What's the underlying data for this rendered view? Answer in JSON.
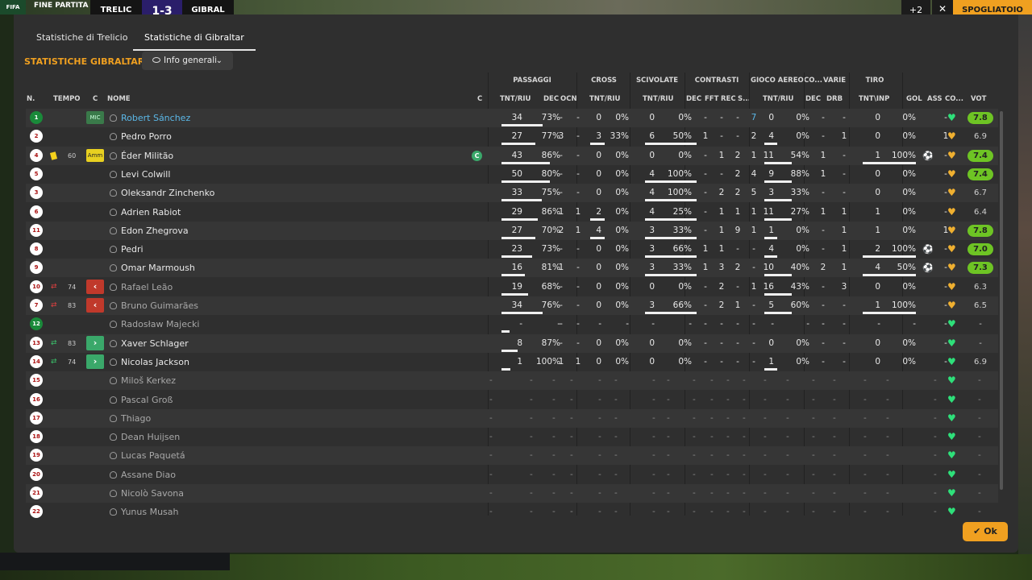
{
  "topbar": {
    "logo": "FIFA",
    "status": "FINE PARTITA",
    "home_team": "TRELIC",
    "score": "1-3",
    "away_team": "GIBRAL",
    "btn1": "+2",
    "close": "✕",
    "dressing_room": "SPOGLIATOIO"
  },
  "tabs": [
    "Statistiche di Trelicio",
    "Statistiche di Gibraltar"
  ],
  "section_title": "STATISTICHE GIBRALTAR",
  "filter": {
    "label": "Info generali"
  },
  "groups": {
    "passaggi": "PASSAGGI",
    "cross": "CROSS",
    "scivolate": "SCIVOLATE",
    "contrasti": "CONTRASTI",
    "gioco_aereo": "GIOCO AEREO",
    "co": "CO...",
    "varie": "VARIE",
    "tiro": "TIRO"
  },
  "columns": {
    "n": "N.",
    "tempo": "TEMPO",
    "c": "C",
    "nome": "NOME",
    "c2": "C",
    "pas_tnt": "TNT/RIU",
    "pas_dec": "DEC",
    "pas_ocn": "OCN",
    "cross_tnt": "TNT/RIU",
    "sci_tnt": "TNT/RIU",
    "con_dec": "DEC",
    "con_fft": "FFT",
    "con_rec": "REC",
    "con_s": "S...",
    "aer_tnt": "TNT/RIU",
    "co_dec": "DEC",
    "var_drb": "DRB",
    "tiro_tnt": "TNT\\INP",
    "gol": "GOL",
    "ass": "ASS",
    "co2": "CO...",
    "vot": "VOT"
  },
  "players": [
    {
      "num": "1",
      "gk": true,
      "pos": "MIC",
      "name": "Robert Sánchez",
      "sel": true,
      "pas": [
        "34",
        "73%"
      ],
      "pdec": "-",
      "pocn": "-",
      "cross": [
        "0",
        "0%"
      ],
      "sci": [
        "0",
        "0%"
      ],
      "cdec": "-",
      "cfft": "-",
      "crec": "-",
      "cs": "7",
      "aer": [
        "0",
        "0%"
      ],
      "codec": "-",
      "drb": "-",
      "tiro": [
        "0",
        "0%"
      ],
      "gol": "",
      "ass": "-",
      "heart": "green",
      "vot": "7.8",
      "vgreen": true
    },
    {
      "num": "2",
      "name": "Pedro Porro",
      "pas": [
        "27",
        "77%"
      ],
      "pdec": "3",
      "pocn": "-",
      "cross": [
        "3",
        "33%"
      ],
      "sci": [
        "6",
        "50%"
      ],
      "cdec": "1",
      "cfft": "-",
      "crec": "-",
      "cs": "2",
      "aer": [
        "4",
        "0%"
      ],
      "codec": "-",
      "drb": "1",
      "tiro": [
        "0",
        "0%"
      ],
      "gol": "",
      "ass": "1",
      "heart": "gold",
      "vot": "6.9"
    },
    {
      "num": "4",
      "card": true,
      "tmin": "60",
      "pos": "Amm",
      "name": "Éder Militão",
      "cap": "C",
      "pas": [
        "43",
        "86%"
      ],
      "pdec": "-",
      "pocn": "-",
      "cross": [
        "0",
        "0%"
      ],
      "sci": [
        "0",
        "0%"
      ],
      "cdec": "-",
      "cfft": "1",
      "crec": "2",
      "cs": "1",
      "aer": [
        "11",
        "54%"
      ],
      "codec": "1",
      "drb": "-",
      "tiro": [
        "1",
        "100%"
      ],
      "gol": "⚽",
      "ass": "-",
      "heart": "gold",
      "vot": "7.4",
      "vgreen": true
    },
    {
      "num": "5",
      "name": "Levi Colwill",
      "pas": [
        "50",
        "80%"
      ],
      "pdec": "-",
      "pocn": "-",
      "cross": [
        "0",
        "0%"
      ],
      "sci": [
        "4",
        "100%"
      ],
      "cdec": "-",
      "cfft": "-",
      "crec": "2",
      "cs": "4",
      "aer": [
        "9",
        "88%"
      ],
      "codec": "1",
      "drb": "-",
      "tiro": [
        "0",
        "0%"
      ],
      "gol": "",
      "ass": "-",
      "heart": "gold",
      "vot": "7.4",
      "vgreen": true
    },
    {
      "num": "3",
      "name": "Oleksandr Zinchenko",
      "pas": [
        "33",
        "75%"
      ],
      "pdec": "-",
      "pocn": "-",
      "cross": [
        "0",
        "0%"
      ],
      "sci": [
        "4",
        "100%"
      ],
      "cdec": "-",
      "cfft": "2",
      "crec": "2",
      "cs": "5",
      "aer": [
        "3",
        "33%"
      ],
      "codec": "-",
      "drb": "-",
      "tiro": [
        "0",
        "0%"
      ],
      "gol": "",
      "ass": "-",
      "heart": "gold",
      "vot": "6.7"
    },
    {
      "num": "6",
      "name": "Adrien Rabiot",
      "pas": [
        "29",
        "86%"
      ],
      "pdec": "1",
      "pocn": "1",
      "cross": [
        "2",
        "0%"
      ],
      "sci": [
        "4",
        "25%"
      ],
      "cdec": "-",
      "cfft": "1",
      "crec": "1",
      "cs": "1",
      "aer": [
        "11",
        "27%"
      ],
      "codec": "1",
      "drb": "1",
      "tiro": [
        "1",
        "0%"
      ],
      "gol": "",
      "ass": "-",
      "heart": "gold",
      "vot": "6.4"
    },
    {
      "num": "11",
      "name": "Edon Zhegrova",
      "pas": [
        "27",
        "70%"
      ],
      "pdec": "2",
      "pocn": "1",
      "cross": [
        "4",
        "0%"
      ],
      "sci": [
        "3",
        "33%"
      ],
      "cdec": "-",
      "cfft": "1",
      "crec": "9",
      "cs": "1",
      "aer": [
        "1",
        "0%"
      ],
      "codec": "-",
      "drb": "1",
      "tiro": [
        "1",
        "0%"
      ],
      "gol": "",
      "ass": "1",
      "heart": "gold",
      "vot": "7.8",
      "vgreen": true
    },
    {
      "num": "8",
      "name": "Pedri",
      "pas": [
        "23",
        "73%"
      ],
      "pdec": "-",
      "pocn": "-",
      "cross": [
        "0",
        "0%"
      ],
      "sci": [
        "3",
        "66%"
      ],
      "cdec": "1",
      "cfft": "1",
      "crec": "-",
      "cs": "-",
      "aer": [
        "4",
        "0%"
      ],
      "codec": "-",
      "drb": "1",
      "tiro": [
        "2",
        "100%"
      ],
      "gol": "⚽",
      "ass": "-",
      "heart": "gold",
      "vot": "7.0",
      "vgreen": true
    },
    {
      "num": "9",
      "name": "Omar Marmoush",
      "pas": [
        "16",
        "81%"
      ],
      "pdec": "1",
      "pocn": "-",
      "cross": [
        "0",
        "0%"
      ],
      "sci": [
        "3",
        "33%"
      ],
      "cdec": "1",
      "cfft": "3",
      "crec": "2",
      "cs": "-",
      "aer": [
        "10",
        "40%"
      ],
      "codec": "2",
      "drb": "1",
      "tiro": [
        "4",
        "50%"
      ],
      "gol": "⚽",
      "ass": "-",
      "heart": "gold",
      "vot": "7.3",
      "vgreen": true
    },
    {
      "num": "10",
      "swap": "out",
      "tmin": "74",
      "sub": "out",
      "name": "Rafael Leão",
      "dim": true,
      "pas": [
        "19",
        "68%"
      ],
      "pdec": "-",
      "pocn": "-",
      "cross": [
        "0",
        "0%"
      ],
      "sci": [
        "0",
        "0%"
      ],
      "cdec": "-",
      "cfft": "2",
      "crec": "-",
      "cs": "1",
      "aer": [
        "16",
        "43%"
      ],
      "codec": "-",
      "drb": "3",
      "tiro": [
        "0",
        "0%"
      ],
      "gol": "",
      "ass": "-",
      "heart": "gold",
      "vot": "6.3"
    },
    {
      "num": "7",
      "swap": "out",
      "tmin": "83",
      "sub": "out",
      "name": "Bruno Guimarães",
      "dim": true,
      "pas": [
        "34",
        "76%"
      ],
      "pdec": "-",
      "pocn": "-",
      "cross": [
        "0",
        "0%"
      ],
      "sci": [
        "3",
        "66%"
      ],
      "cdec": "-",
      "cfft": "2",
      "crec": "1",
      "cs": "-",
      "aer": [
        "5",
        "60%"
      ],
      "codec": "-",
      "drb": "-",
      "tiro": [
        "1",
        "100%"
      ],
      "gol": "",
      "ass": "-",
      "heart": "gold",
      "vot": "6.5"
    },
    {
      "num": "12",
      "gk": true,
      "name": "Radosław Majecki",
      "dim": true,
      "pas": [
        "-",
        "-"
      ],
      "pdec": "-",
      "pocn": "-",
      "cross": [
        "-",
        "-"
      ],
      "sci": [
        "-",
        "-"
      ],
      "cdec": "-",
      "cfft": "-",
      "crec": "-",
      "cs": "-",
      "aer": [
        "-",
        "-"
      ],
      "codec": "-",
      "drb": "-",
      "tiro": [
        "-",
        "-"
      ],
      "gol": "",
      "ass": "-",
      "heart": "green",
      "vot": "-"
    },
    {
      "num": "13",
      "swap": "in",
      "tmin": "83",
      "sub": "in",
      "name": "Xaver Schlager",
      "pas": [
        "8",
        "87%"
      ],
      "pdec": "-",
      "pocn": "-",
      "cross": [
        "0",
        "0%"
      ],
      "sci": [
        "0",
        "0%"
      ],
      "cdec": "-",
      "cfft": "-",
      "crec": "-",
      "cs": "-",
      "aer": [
        "0",
        "0%"
      ],
      "codec": "-",
      "drb": "-",
      "tiro": [
        "0",
        "0%"
      ],
      "gol": "",
      "ass": "-",
      "heart": "green",
      "vot": "-"
    },
    {
      "num": "14",
      "swap": "in",
      "tmin": "74",
      "sub": "in",
      "name": "Nicolas Jackson",
      "pas": [
        "1",
        "100%"
      ],
      "pdec": "1",
      "pocn": "1",
      "cross": [
        "0",
        "0%"
      ],
      "sci": [
        "0",
        "0%"
      ],
      "cdec": "-",
      "cfft": "-",
      "crec": "-",
      "cs": "-",
      "aer": [
        "1",
        "0%"
      ],
      "codec": "-",
      "drb": "-",
      "tiro": [
        "0",
        "0%"
      ],
      "gol": "",
      "ass": "-",
      "heart": "green",
      "vot": "6.9"
    },
    {
      "num": "15",
      "name": "Miloš Kerkez",
      "dim": true,
      "empty": true
    },
    {
      "num": "16",
      "name": "Pascal Groß",
      "dim": true,
      "empty": true
    },
    {
      "num": "17",
      "name": "Thiago",
      "dim": true,
      "empty": true
    },
    {
      "num": "18",
      "name": "Dean Huijsen",
      "dim": true,
      "empty": true
    },
    {
      "num": "19",
      "name": "Lucas Paquetá",
      "dim": true,
      "empty": true
    },
    {
      "num": "20",
      "name": "Assane Diao",
      "dim": true,
      "empty": true
    },
    {
      "num": "21",
      "name": "Nicolò Savona",
      "dim": true,
      "empty": true
    },
    {
      "num": "22",
      "name": "Yunus Musah",
      "dim": true,
      "empty": true
    }
  ],
  "ok_button": "Ok",
  "colors": {
    "accent": "#f0a020",
    "rating_green": "#6ec424",
    "heart_green": "#2ee07a",
    "heart_gold": "#f0b030",
    "selected": "#5bb8e8"
  }
}
